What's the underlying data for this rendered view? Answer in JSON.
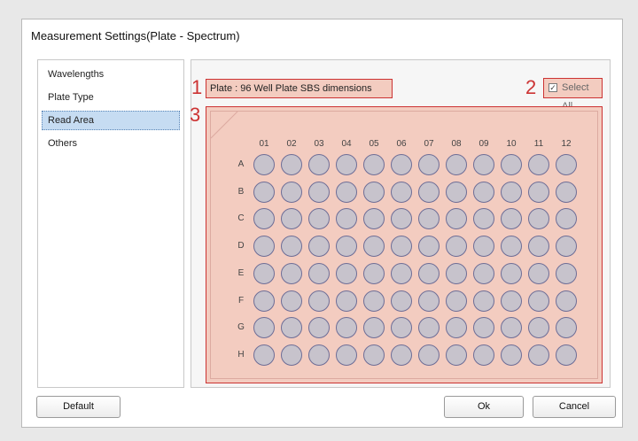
{
  "dialog": {
    "title": "Measurement Settings(Plate - Spectrum)"
  },
  "sidebar": {
    "items": [
      {
        "label": "Wavelengths",
        "selected": false
      },
      {
        "label": "Plate Type",
        "selected": false
      },
      {
        "label": "Read Area",
        "selected": true
      },
      {
        "label": "Others",
        "selected": false
      }
    ]
  },
  "callouts": [
    "1",
    "2",
    "3"
  ],
  "plate": {
    "label": "Plate : 96 Well Plate SBS dimensions",
    "select_all_label": "Select All",
    "select_all_checked": true,
    "columns": [
      "01",
      "02",
      "03",
      "04",
      "05",
      "06",
      "07",
      "08",
      "09",
      "10",
      "11",
      "12"
    ],
    "rows": [
      "A",
      "B",
      "C",
      "D",
      "E",
      "F",
      "G",
      "H"
    ]
  },
  "buttons": {
    "default": "Default",
    "ok": "Ok",
    "cancel": "Cancel"
  },
  "colors": {
    "highlight": "#f3ccc0",
    "callout_border": "#cc3333",
    "well_fill": "#c7c3cc",
    "well_stroke": "#6d6d96",
    "selected_item": "#c6dcf2"
  }
}
